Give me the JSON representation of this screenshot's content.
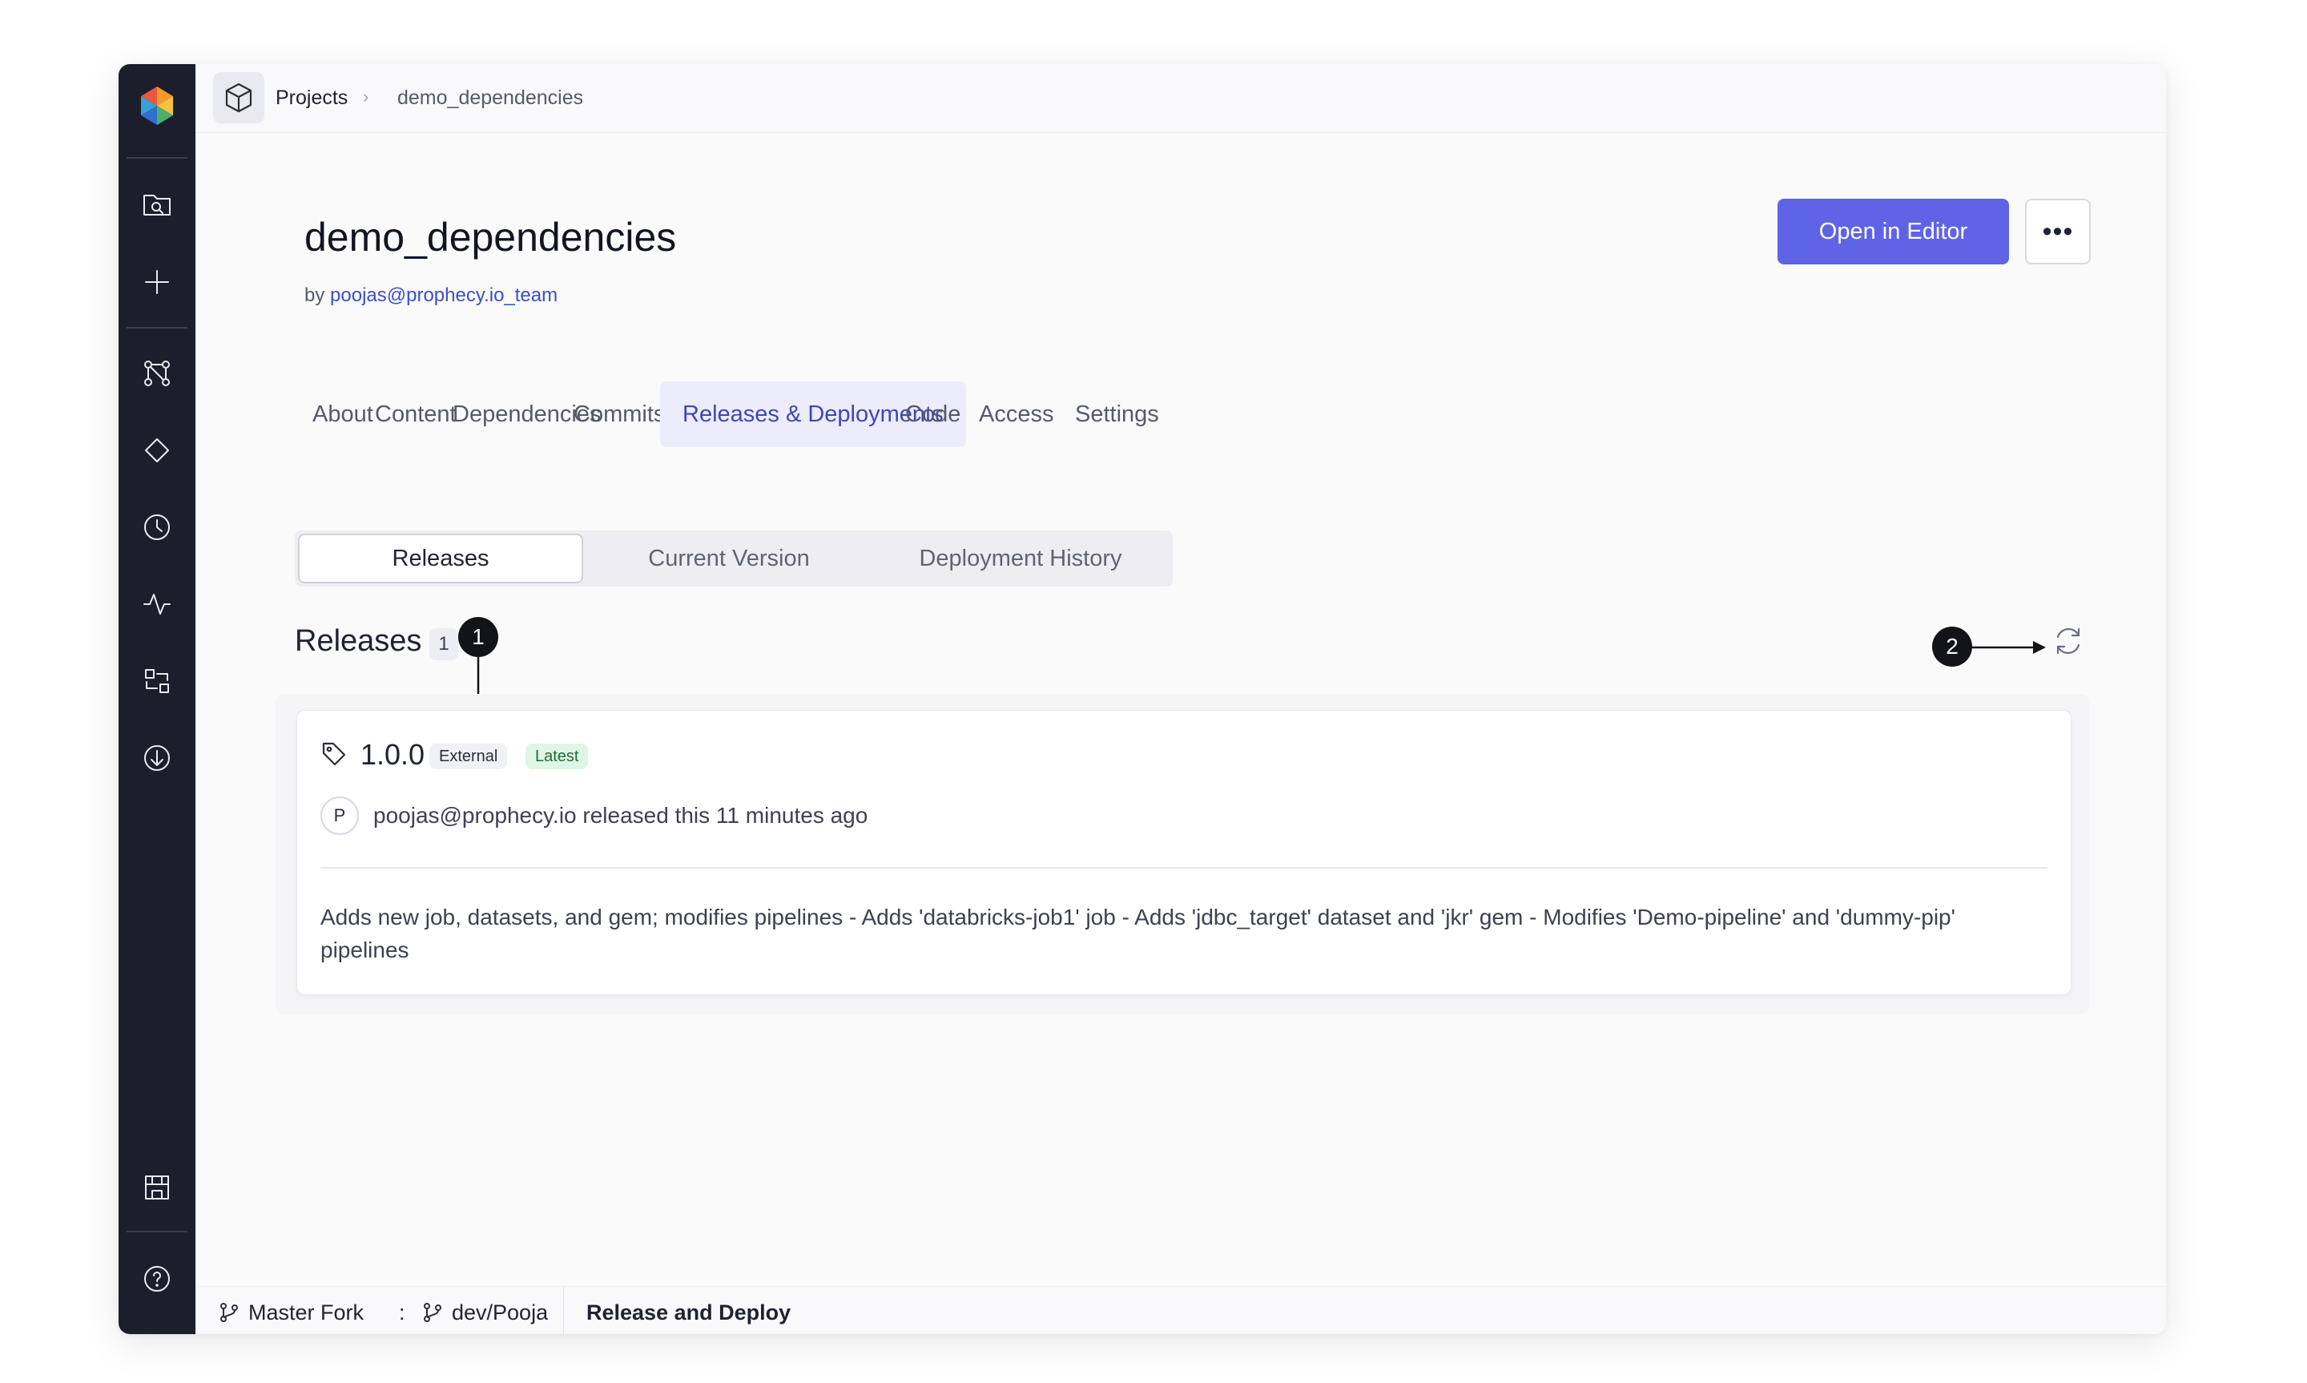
{
  "breadcrumb": {
    "root": "Projects",
    "separator": "›",
    "current": "demo_dependencies"
  },
  "project": {
    "title": "demo_dependencies",
    "by_prefix": "by",
    "owner": "poojas@prophecy.io_team",
    "open_button": "Open in Editor",
    "more_button": "•••"
  },
  "tabs": [
    {
      "label": "About"
    },
    {
      "label": "Content"
    },
    {
      "label": "Dependencies"
    },
    {
      "label": "Commits"
    },
    {
      "label": "Releases & Deployments",
      "active": true
    },
    {
      "label": "Code"
    },
    {
      "label": "Access"
    },
    {
      "label": "Settings"
    }
  ],
  "subtabs": [
    {
      "label": "Releases",
      "active": true
    },
    {
      "label": "Current Version"
    },
    {
      "label": "Deployment History"
    }
  ],
  "releases": {
    "heading": "Releases",
    "count": "1",
    "items": [
      {
        "version": "1.0.0",
        "badges": [
          "External",
          "Latest"
        ],
        "avatar_initial": "P",
        "meta": "poojas@prophecy.io released this 11 minutes ago",
        "description": "Adds new job, datasets, and gem; modifies pipelines - Adds 'databricks-job1' job - Adds 'jdbc_target' dataset and 'jkr' gem - Modifies 'Demo-pipeline' and 'dummy-pip' pipelines"
      }
    ]
  },
  "annotations": {
    "marker1": "1",
    "marker2": "2"
  },
  "bottom_bar": {
    "fork": "Master Fork",
    "separator": ":",
    "branch": "dev/Pooja",
    "mode": "Release and Deploy"
  },
  "colors": {
    "sidebar": "#1c1f2b",
    "accent": "#5f63e6",
    "active_tab_bg": "#ececfd",
    "active_tab_text": "#3e47b6",
    "latest_badge_bg": "#dff6e6"
  },
  "icons": {
    "sidebar": [
      "logo",
      "search-folder-icon",
      "plus-icon",
      "pipeline-icon",
      "gem-icon",
      "clock-icon",
      "activity-icon",
      "transform-icon",
      "download-icon",
      "marketplace-icon",
      "help-icon",
      "ellipsis-icon"
    ],
    "project": "cube-icon",
    "tag": "tag-icon",
    "refresh": "refresh-icon",
    "branch": "git-branch-icon"
  }
}
